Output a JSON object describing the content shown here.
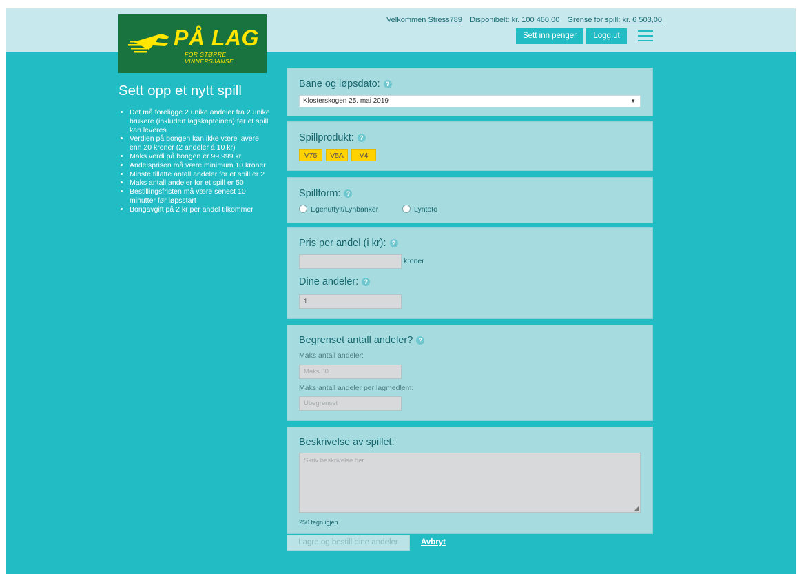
{
  "logo": {
    "brand": "PÅ LAG",
    "tagline": "FOR STØRRE VINNERSJANSE"
  },
  "user": {
    "welcome": "Velkommen",
    "username": "Stress789",
    "available": "Disponibelt: kr. 100 460,00",
    "limit_label": "Grense for spill:",
    "limit_value": "kr. 6 503,00"
  },
  "header": {
    "deposit_label": "Sett inn penger",
    "logout_label": "Logg ut"
  },
  "sidebar": {
    "title": "Sett opp et nytt spill",
    "rules": [
      "Det må foreligge 2 unike andeler fra 2 unike brukere (inkludert lagskapteinen) før et spill kan leveres",
      "Verdien på bongen kan ikke være lavere enn 20 kroner (2 andeler á 10 kr)",
      "Maks verdi på bongen er 99.999 kr",
      "Andelsprisen må være minimum 10 kroner",
      "Minste tillatte antall andeler for et spill er 2",
      "Maks antall andeler for et spill er 50",
      "Bestillingsfristen må være senest 10 minutter før løpsstart",
      "Bongavgift på 2 kr per andel tilkommer"
    ]
  },
  "form": {
    "race": {
      "label": "Bane og løpsdato:",
      "selected": "Klosterskogen 25. mai 2019"
    },
    "product": {
      "label": "Spillprodukt:",
      "options": [
        "V75",
        "V5A",
        "V4"
      ]
    },
    "form_type": {
      "label": "Spillform:",
      "options": [
        "Egenutfylt/Lynbanker",
        "Lyntoto"
      ]
    },
    "price": {
      "label": "Pris per andel (i kr):",
      "value": "",
      "unit": "kroner"
    },
    "shares": {
      "label": "Dine andeler:",
      "value": "1"
    },
    "limit": {
      "label": "Begrenset antall andeler?",
      "max_label": "Maks antall andeler:",
      "max_placeholder": "Maks 50",
      "per_member_label": "Maks antall andeler per lagmedlem:",
      "per_member_placeholder": "Ubegrenset"
    },
    "description": {
      "label": "Beskrivelse av spillet:",
      "placeholder": "Skriv beskrivelse her",
      "counter": "250 tegn igjen"
    },
    "submit_label": "Lagre og bestill dine andeler",
    "cancel_label": "Avbryt"
  },
  "colors": {
    "teal": "#21bcc4",
    "light_band": "#c7e8ec",
    "panel": "#a6dcdf",
    "logo_green": "#19733f",
    "yellow": "#ffd200"
  },
  "icons": [
    "horse-logo-icon",
    "help-icon",
    "hamburger-menu-icon",
    "dropdown-caret-icon",
    "resize-grip-icon"
  ]
}
